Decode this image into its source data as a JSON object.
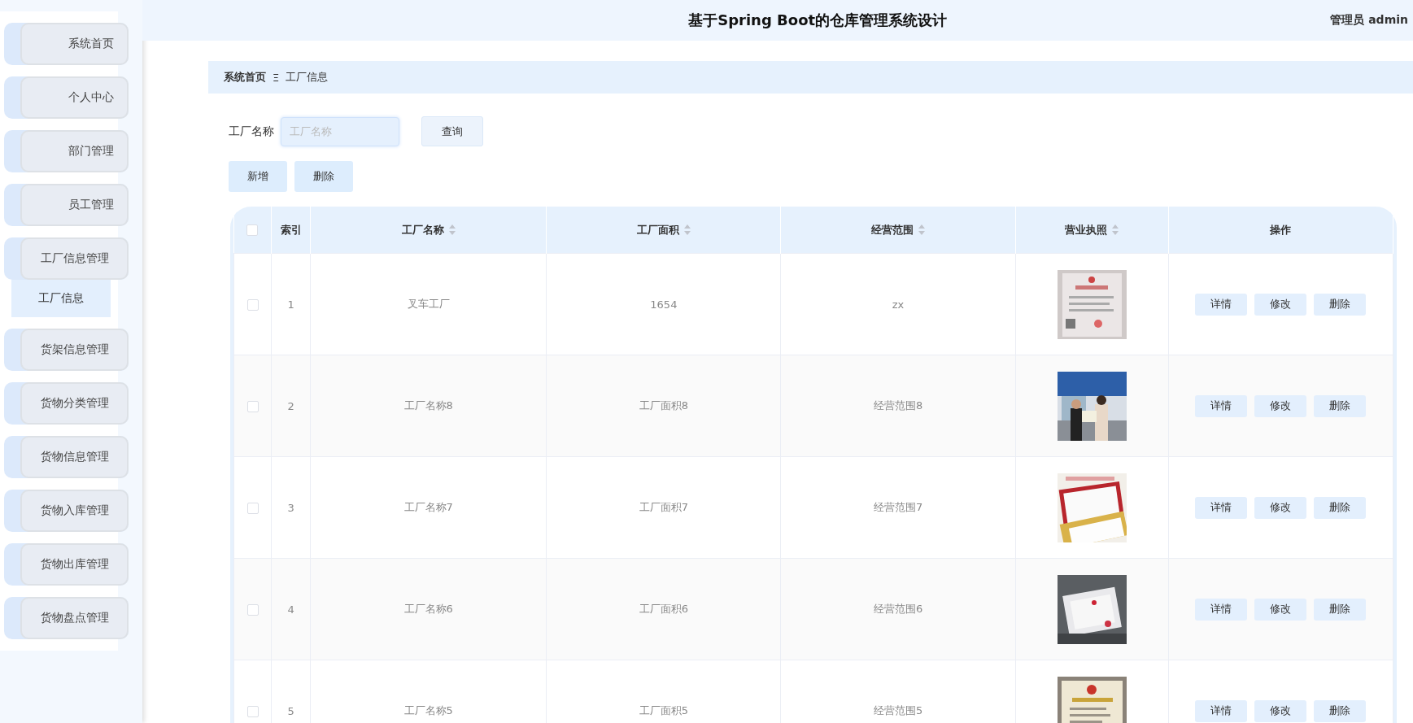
{
  "sidebar": {
    "items": [
      {
        "label": "系统首页",
        "selected": false
      },
      {
        "label": "个人中心",
        "selected": false
      },
      {
        "label": "部门管理",
        "selected": false
      },
      {
        "label": "员工管理",
        "selected": false
      },
      {
        "label": "工厂信息管理",
        "selected": false,
        "expanded": true,
        "children": [
          {
            "label": "工厂信息",
            "selected": true
          }
        ]
      },
      {
        "label": "货架信息管理",
        "selected": false
      },
      {
        "label": "货物分类管理",
        "selected": false
      },
      {
        "label": "货物信息管理",
        "selected": false
      },
      {
        "label": "货物入库管理",
        "selected": false
      },
      {
        "label": "货物出库管理",
        "selected": false
      },
      {
        "label": "货物盘点管理",
        "selected": false
      }
    ]
  },
  "header": {
    "title": "基于Spring Boot的仓库管理系统设计",
    "user": "管理员 admin"
  },
  "breadcrumb": {
    "items": [
      "系统首页",
      "工厂信息"
    ],
    "separator": "Ξ"
  },
  "search": {
    "label": "工厂名称",
    "placeholder": "工厂名称",
    "button": "查询"
  },
  "toolbar": {
    "buttons": [
      "新增",
      "删除"
    ]
  },
  "table": {
    "header_checked": false,
    "columns": [
      {
        "label": "索引",
        "sortable": false
      },
      {
        "label": "工厂名称",
        "sortable": true
      },
      {
        "label": "工厂面积",
        "sortable": true
      },
      {
        "label": "经营范围",
        "sortable": true
      },
      {
        "label": "营业执照",
        "sortable": true
      },
      {
        "label": "操作",
        "sortable": false
      }
    ],
    "rows": [
      {
        "checked": false,
        "index": "1",
        "name": "叉车工厂",
        "area": "1654",
        "scope": "zx",
        "actions": [
          "详情",
          "修改",
          "删除"
        ]
      },
      {
        "checked": false,
        "index": "2",
        "name": "工厂名称8",
        "area": "工厂面积8",
        "scope": "经营范围8",
        "actions": [
          "详情",
          "修改",
          "删除"
        ]
      },
      {
        "checked": false,
        "index": "3",
        "name": "工厂名称7",
        "area": "工厂面积7",
        "scope": "经营范围7",
        "actions": [
          "详情",
          "修改",
          "删除"
        ]
      },
      {
        "checked": false,
        "index": "4",
        "name": "工厂名称6",
        "area": "工厂面积6",
        "scope": "经营范围6",
        "actions": [
          "详情",
          "修改",
          "删除"
        ]
      },
      {
        "checked": false,
        "index": "5",
        "name": "工厂名称5",
        "area": "工厂面积5",
        "scope": "经营范围5",
        "actions": [
          "详情",
          "修改",
          "删除"
        ]
      }
    ]
  }
}
